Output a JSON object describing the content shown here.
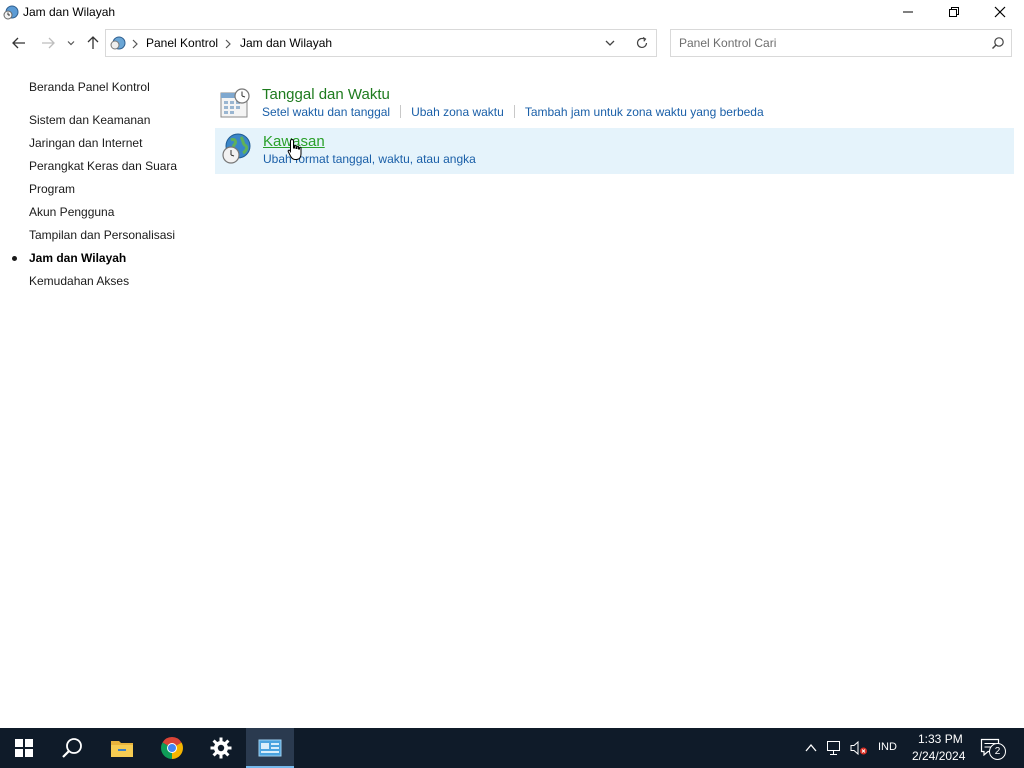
{
  "window": {
    "title": "Jam dan Wilayah",
    "controls": [
      "minimize-icon",
      "restore-icon",
      "close-icon"
    ]
  },
  "navigation": {
    "breadcrumbs": [
      "Panel Kontrol",
      "Jam dan Wilayah"
    ],
    "search_placeholder": "Panel Kontrol Cari"
  },
  "sidebar": {
    "items": [
      {
        "label": "Beranda Panel Kontrol",
        "active": false
      },
      {
        "label": "Sistem dan Keamanan",
        "active": false
      },
      {
        "label": "Jaringan dan Internet",
        "active": false
      },
      {
        "label": "Perangkat Keras dan Suara",
        "active": false
      },
      {
        "label": "Program",
        "active": false
      },
      {
        "label": "Akun Pengguna",
        "active": false
      },
      {
        "label": "Tampilan dan Personalisasi",
        "active": false
      },
      {
        "label": "Jam dan Wilayah",
        "active": true
      },
      {
        "label": "Kemudahan Akses",
        "active": false
      }
    ]
  },
  "categories": [
    {
      "title": "Tanggal dan Waktu",
      "icon": "calendar-clock-icon",
      "links": [
        "Setel waktu dan tanggal",
        "Ubah zona waktu",
        "Tambah jam untuk zona waktu yang berbeda"
      ]
    },
    {
      "title": "Kawasan",
      "icon": "globe-clock-icon",
      "links": [
        "Ubah format tanggal, waktu, atau angka"
      ],
      "hovered": true
    }
  ],
  "taskbar": {
    "apps": [
      "windows-start-icon",
      "search-icon",
      "file-explorer-icon",
      "chrome-icon",
      "settings-icon",
      "control-panel-icon"
    ],
    "tray": {
      "language": "IND",
      "time": "1:33 PM",
      "date": "2/24/2024",
      "notification_count": "2"
    }
  },
  "colors": {
    "category_title": "#1e7b1e",
    "link": "#1a5fa8",
    "hover_highlight": "#e5f3fb",
    "taskbar": "#0f1b29"
  }
}
